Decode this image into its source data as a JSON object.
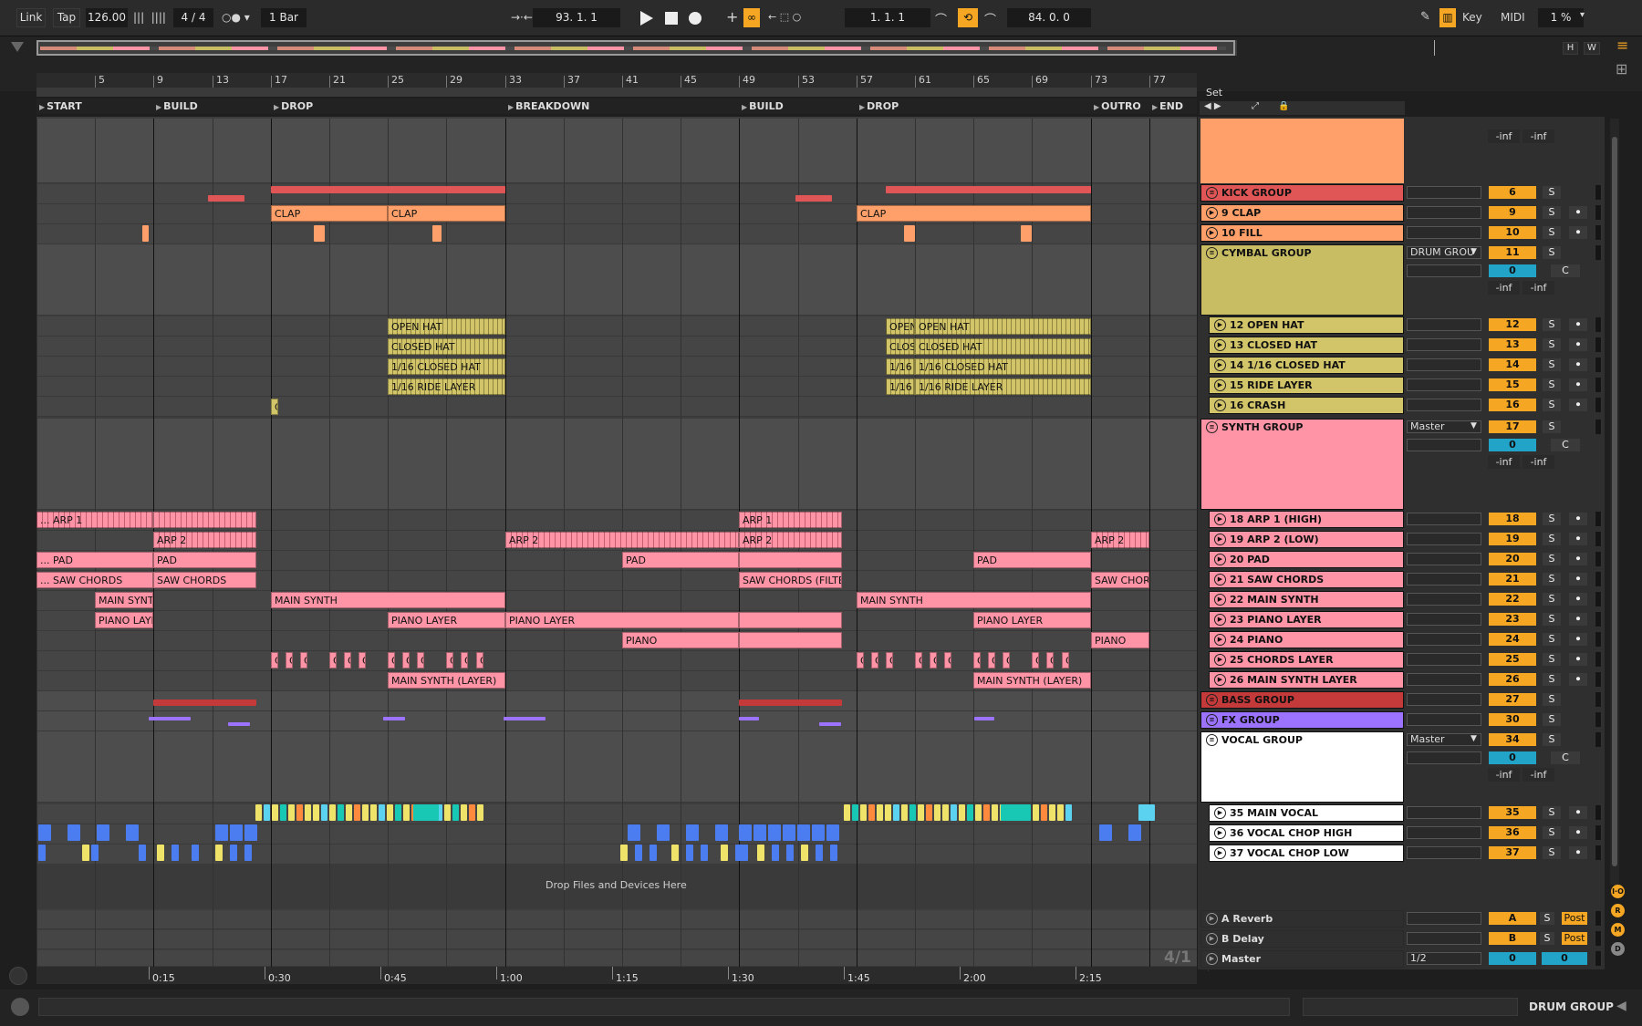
{
  "toolbar": {
    "link": "Link",
    "tap": "Tap",
    "tempo": "126.00",
    "signature": "4 / 4",
    "quantize": "1 Bar",
    "position": "93.  1.  1",
    "loop_start": "1.  1.  1",
    "loop_length": "84.  0.  0",
    "key": "Key",
    "midi": "MIDI",
    "cpu": "1 %"
  },
  "overview": {
    "h": "H",
    "w": "W"
  },
  "ruler_bars": [
    "5",
    "9",
    "13",
    "17",
    "21",
    "25",
    "29",
    "33",
    "37",
    "41",
    "45",
    "49",
    "53",
    "57",
    "61",
    "65",
    "69",
    "73",
    "77"
  ],
  "set_label": "Set",
  "locators": [
    "START",
    "BUILD",
    "DROP",
    "BREAKDOWN",
    "BUILD",
    "DROP",
    "OUTRO",
    "END"
  ],
  "clips": {
    "clap": "CLAP",
    "open_hat": "OPEN HAT",
    "open_short": "OPEN",
    "closed_hat": "CLOSED HAT",
    "clos_short": "CLOS",
    "closed16": "1/16 CLOSED HAT",
    "ride16": "1/16 RIDE LAYER",
    "short116": "1/16",
    "c": "C",
    "arp1_cut": "... ARP 1",
    "arp1": "ARP 1",
    "arp2": "ARP 2",
    "pad_cut": "... PAD",
    "pad": "PAD",
    "sawchords_cut": "... SAW CHORDS",
    "sawchords": "SAW CHORDS",
    "sawchords_filter": "SAW CHORDS (FILTE",
    "saw_chor": "SAW CHOR",
    "main_synt": "MAIN SYNT",
    "main_synth": "MAIN SYNTH",
    "piano_laye": "PIANO LAYE",
    "piano_layer": "PIANO LAYER",
    "piano": "PIANO",
    "main_synth_layer": "MAIN SYNTH (LAYER)"
  },
  "drop_hint": "Drop Files and Devices Here",
  "tracks": [
    {
      "name": "KICK GROUP",
      "num": "6",
      "color": "#e05656"
    },
    {
      "name": "9 CLAP",
      "num": "9",
      "color": "#ffa06a"
    },
    {
      "name": "10 FILL",
      "num": "10",
      "color": "#ffa06a"
    },
    {
      "name": "CYMBAL GROUP",
      "num": "11",
      "route": "DRUM GROU",
      "vol": "0",
      "pan": "C",
      "inf_l": "-inf",
      "inf_r": "-inf",
      "color": "#c9bd63"
    },
    {
      "name": "12 OPEN HAT",
      "num": "12"
    },
    {
      "name": "13 CLOSED HAT",
      "num": "13"
    },
    {
      "name": "14 1/16 CLOSED HAT",
      "num": "14"
    },
    {
      "name": "15 RIDE LAYER",
      "num": "15"
    },
    {
      "name": "16 CRASH",
      "num": "16"
    },
    {
      "name": "SYNTH GROUP",
      "num": "17",
      "route": "Master",
      "vol": "0",
      "pan": "C",
      "inf_l": "-inf",
      "inf_r": "-inf",
      "color": "#ff94a6"
    },
    {
      "name": "18 ARP 1 (HIGH)",
      "num": "18"
    },
    {
      "name": "19 ARP 2 (LOW)",
      "num": "19"
    },
    {
      "name": "20 PAD",
      "num": "20"
    },
    {
      "name": "21 SAW CHORDS",
      "num": "21"
    },
    {
      "name": "22 MAIN SYNTH",
      "num": "22"
    },
    {
      "name": "23 PIANO LAYER",
      "num": "23"
    },
    {
      "name": "24 PIANO",
      "num": "24"
    },
    {
      "name": "25 CHORDS LAYER",
      "num": "25"
    },
    {
      "name": "26 MAIN SYNTH LAYER",
      "num": "26"
    },
    {
      "name": "BASS GROUP",
      "num": "27",
      "color": "#c43a3a"
    },
    {
      "name": "FX GROUP",
      "num": "30",
      "color": "#9b73ff"
    },
    {
      "name": "VOCAL GROUP",
      "num": "34",
      "route": "Master",
      "vol": "0",
      "pan": "C",
      "inf_l": "-inf",
      "inf_r": "-inf",
      "color": "#ffffff"
    },
    {
      "name": "35 MAIN VOCAL",
      "num": "35"
    },
    {
      "name": "36 VOCAL CHOP HIGH",
      "num": "36"
    },
    {
      "name": "37 VOCAL CHOP LOW",
      "num": "37"
    }
  ],
  "top_partial": {
    "inf_l": "-inf",
    "inf_r": "-inf"
  },
  "returns": [
    {
      "name": "A Reverb",
      "num": "A",
      "post": "Post",
      "solo": "S"
    },
    {
      "name": "B Delay",
      "num": "B",
      "post": "Post",
      "solo": "S"
    },
    {
      "name": "Master",
      "num": "0",
      "route": "1/2",
      "vol2": "0"
    }
  ],
  "solo": "S",
  "zoom_label": "4/1",
  "time_ticks": [
    "0:15",
    "0:30",
    "0:45",
    "1:00",
    "1:15",
    "1:30",
    "1:45",
    "2:00",
    "2:15"
  ],
  "status": {
    "selected": "DRUM GROUP"
  },
  "side_buttons": [
    "I·O",
    "R",
    "M",
    "D"
  ]
}
